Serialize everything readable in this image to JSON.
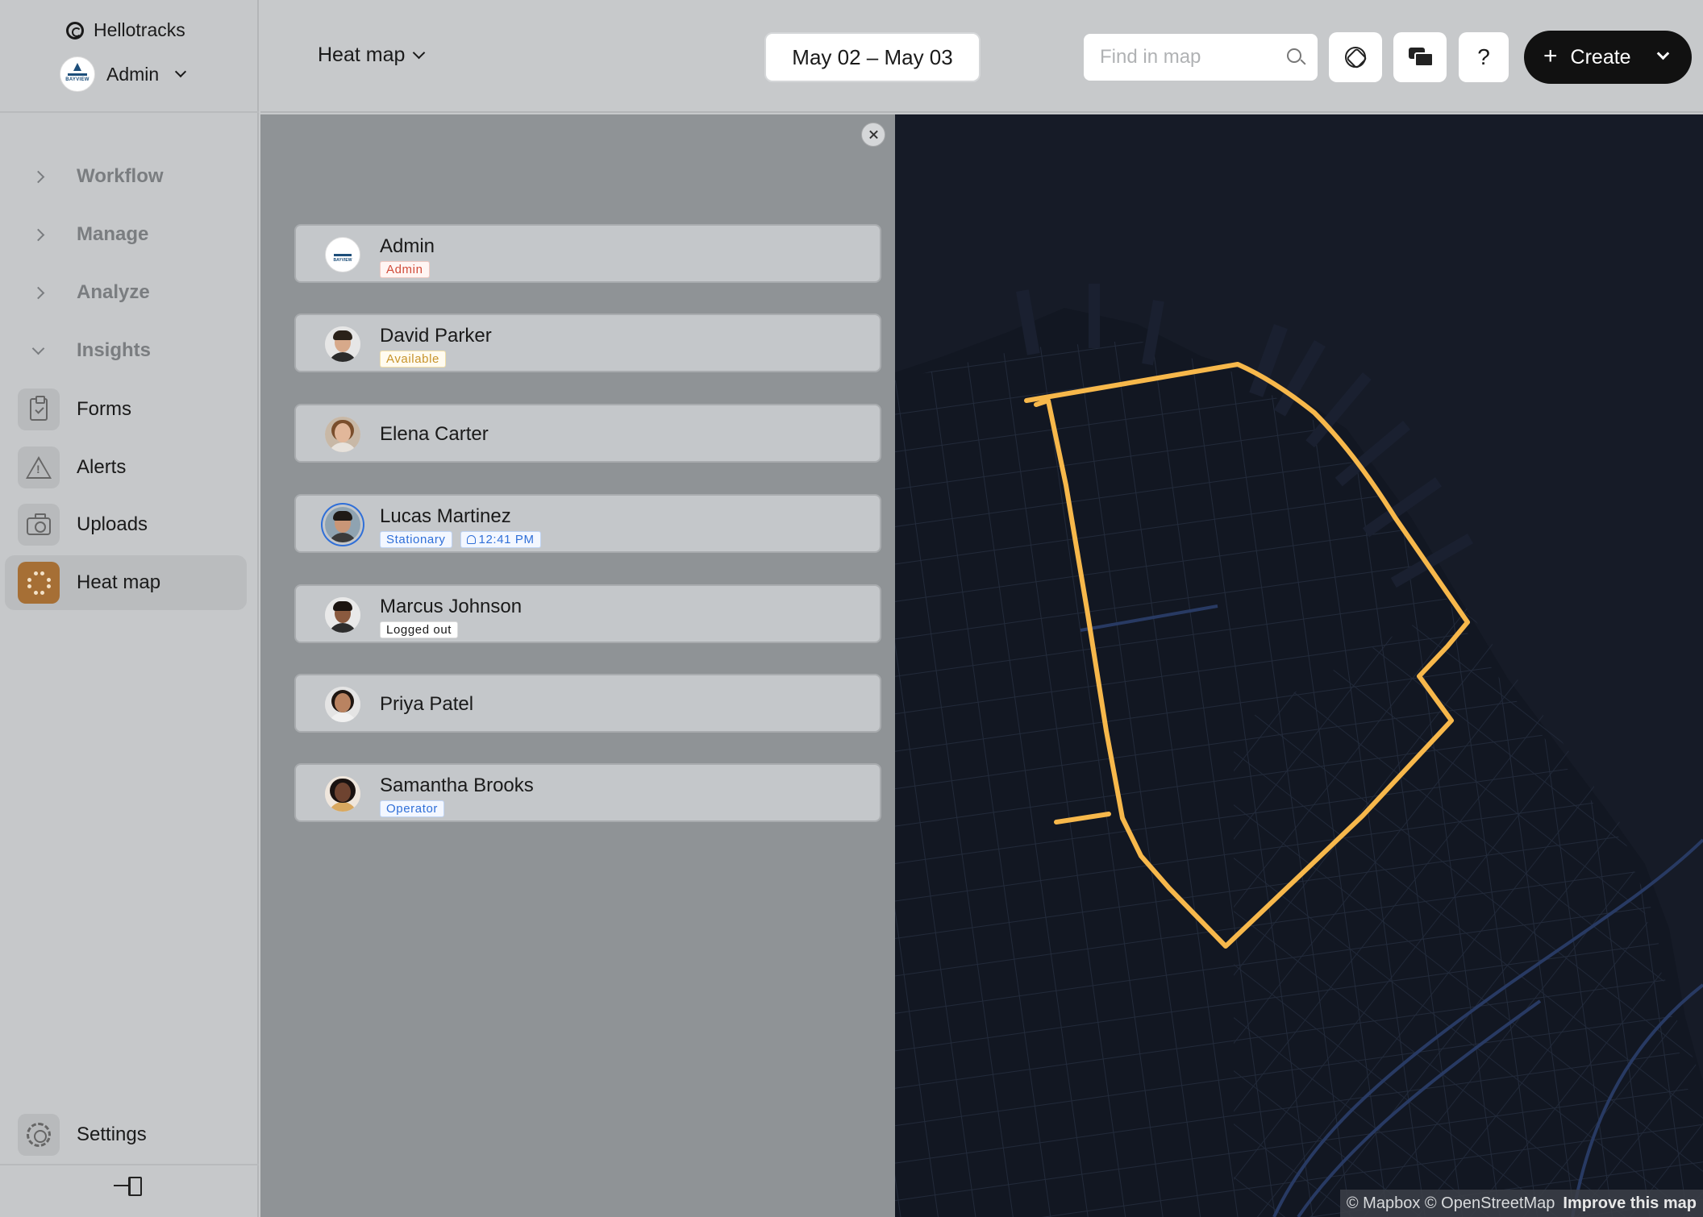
{
  "app": {
    "brand": "Hellotracks",
    "account_name": "Admin",
    "account_logo_text": "BAYVIEW"
  },
  "sidebar": {
    "groups": [
      {
        "label": "Workflow",
        "expanded": false
      },
      {
        "label": "Manage",
        "expanded": false
      },
      {
        "label": "Analyze",
        "expanded": false
      },
      {
        "label": "Insights",
        "expanded": true
      }
    ],
    "items": [
      {
        "label": "Forms",
        "icon": "clipboard-check-icon"
      },
      {
        "label": "Alerts",
        "icon": "warning-triangle-icon"
      },
      {
        "label": "Uploads",
        "icon": "camera-icon"
      },
      {
        "label": "Heat map",
        "icon": "heat-grid-icon",
        "active": true
      }
    ],
    "settings_label": "Settings"
  },
  "topbar": {
    "view_label": "Heat map",
    "date_range": "May 02 – May 03",
    "search_placeholder": "Find in map",
    "help_label": "?",
    "create_label": "Create"
  },
  "users": [
    {
      "name": "Admin",
      "badges": [
        {
          "text": "Admin",
          "color": "red"
        }
      ]
    },
    {
      "name": "David Parker",
      "badges": [
        {
          "text": "Available",
          "color": "yellow"
        }
      ]
    },
    {
      "name": "Elena Carter",
      "badges": []
    },
    {
      "name": "Lucas Martinez",
      "badges": [
        {
          "text": "Stationary",
          "color": "blue"
        },
        {
          "text": "12:41 PM",
          "color": "blue"
        }
      ]
    },
    {
      "name": "Marcus Johnson",
      "badges": [
        {
          "text": "Logged out",
          "color": "dark"
        }
      ]
    },
    {
      "name": "Priya Patel",
      "badges": []
    },
    {
      "name": "Samantha Brooks",
      "badges": [
        {
          "text": "Operator",
          "color": "blue"
        }
      ]
    }
  ],
  "map": {
    "route_color": "#f7b84b",
    "attribution": "© Mapbox © OpenStreetMap",
    "improve_label": "Improve this map"
  }
}
